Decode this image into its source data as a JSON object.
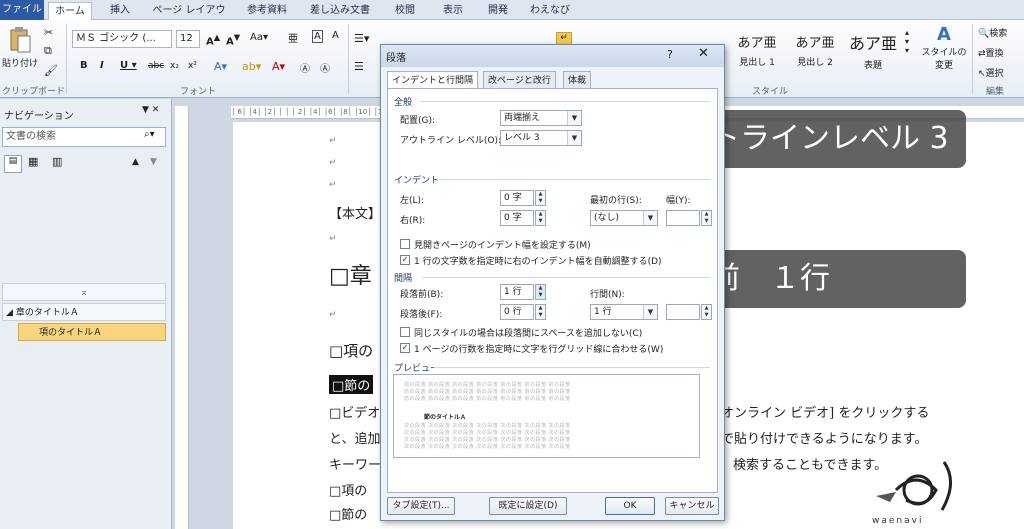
{
  "ribbon": {
    "tabs": [
      "ファイル",
      "ホーム",
      "挿入",
      "ページ レイアウト",
      "参考資料",
      "差し込み文書",
      "校閲",
      "表示",
      "開発",
      "わえなび"
    ],
    "active_tab": "ホーム",
    "paste_label": "貼り付け",
    "font_name": "ＭＳ ゴシック (...",
    "font_size": "12",
    "clipboard_group": "クリップボード",
    "font_group": "フォント",
    "style_group": "スタイル",
    "edit_group": "編集",
    "styles": [
      {
        "sample": "あア亜",
        "label": "見出し 1"
      },
      {
        "sample": "あア亜",
        "label": "見出し 2"
      },
      {
        "sample": "あア亜",
        "label": "表題"
      }
    ],
    "style_change_line1": "スタイルの",
    "style_change_line2": "変更",
    "edit_items": [
      "検索",
      "置換",
      "選択"
    ]
  },
  "nav": {
    "title": "ナビゲーション",
    "search_placeholder": "文書の検索",
    "items": [
      {
        "label": "章のタイトルＡ"
      },
      {
        "label": "項のタイトルＡ"
      }
    ]
  },
  "document": {
    "line_body": "【本文】",
    "line_chapter": "□章",
    "line_item1": "□項の",
    "line_section": "□節の",
    "line_video": "□ビデオ",
    "line_video_right": "オンライン ビデオ] をクリックする",
    "line_add": "と、追加",
    "line_add_right": "で貼り付けできるようになります。",
    "line_keyword": "キーワー",
    "line_keyword_right": "検索することもできます。",
    "line_item2": "□項の",
    "line_section2": "□節の"
  },
  "overlays": {
    "outline_level": "アウトラインレベル 3",
    "spacing_before": "段落前　１行"
  },
  "dialog": {
    "title": "段落",
    "help": "?",
    "tabs": [
      "インデントと行間隔",
      "改ページと改行",
      "体裁"
    ],
    "general_section": "全般",
    "alignment_label": "配置(G):",
    "alignment_value": "両端揃え",
    "outline_label": "アウトライン レベル(O):",
    "outline_value": "レベル 3",
    "indent_section": "インデント",
    "left_label": "左(L):",
    "left_value": "0 字",
    "right_label": "右(R):",
    "right_value": "0 字",
    "first_line_label": "最初の行(S):",
    "first_line_value": "(なし)",
    "width_label": "幅(Y):",
    "mirror_label": "見開きページのインデント幅を設定する(M)",
    "auto_indent_label": "1 行の文字数を指定時に右のインデント幅を自動調整する(D)",
    "spacing_section": "間隔",
    "before_label": "段落前(B):",
    "before_value": "1 行",
    "after_label": "段落後(F):",
    "after_value": "0 行",
    "line_spacing_label": "行間(N):",
    "line_spacing_value": "1 行",
    "same_style_label": "同じスタイルの場合は段落間にスペースを追加しない(C)",
    "grid_label": "1 ページの行数を指定時に文字を行グリッド線に合わせる(W)",
    "preview_section": "プレビュー",
    "preview_prev": "前の段落 前の段落 前の段落 前の段落 前の段落 前の段落 前の段落",
    "preview_title": "節のタイトルＡ",
    "preview_next": "次の段落 次の段落 次の段落 次の段落 次の段落 次の段落 次の段落",
    "tabs_button": "タブ設定(T)...",
    "default_button": "既定に設定(D)",
    "ok_button": "OK",
    "cancel_button": "キャンセル"
  },
  "logo_text": "waenavi"
}
